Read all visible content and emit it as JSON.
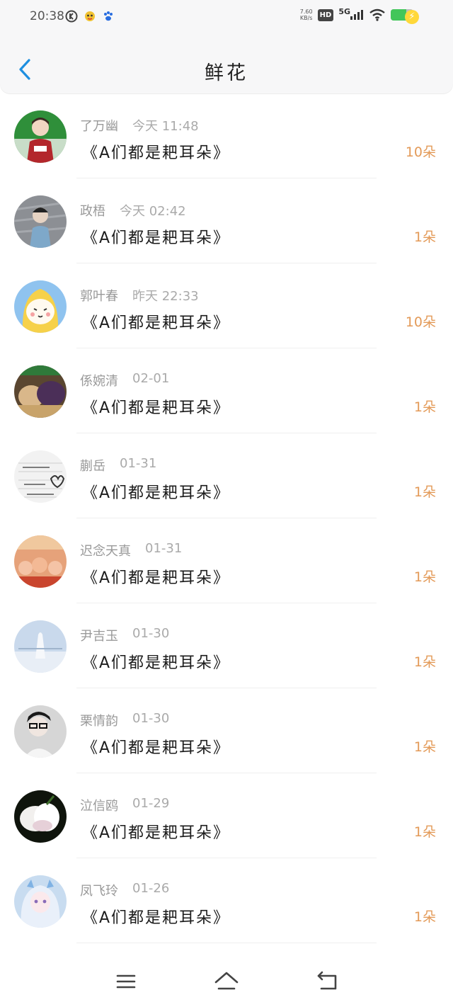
{
  "status_bar": {
    "time": "20:38",
    "net_speed_value": "7.60",
    "net_speed_unit": "KB/s",
    "hd": "HD",
    "network": "5G",
    "battery_level": 0.7
  },
  "header": {
    "title": "鲜花"
  },
  "gifts": [
    {
      "name": "了万幽",
      "time": "今天 11:48",
      "title": "《A们都是耙耳朵》",
      "count": "10朵"
    },
    {
      "name": "政梧",
      "time": "今天 02:42",
      "title": "《A们都是耙耳朵》",
      "count": "1朵"
    },
    {
      "name": "郭叶春",
      "time": "昨天 22:33",
      "title": "《A们都是耙耳朵》",
      "count": "10朵"
    },
    {
      "name": "係婉清",
      "time": "02-01",
      "title": "《A们都是耙耳朵》",
      "count": "1朵"
    },
    {
      "name": "蒯岳",
      "time": "01-31",
      "title": "《A们都是耙耳朵》",
      "count": "1朵"
    },
    {
      "name": "迟念天真",
      "time": "01-31",
      "title": "《A们都是耙耳朵》",
      "count": "1朵"
    },
    {
      "name": "尹吉玉",
      "time": "01-30",
      "title": "《A们都是耙耳朵》",
      "count": "1朵"
    },
    {
      "name": "栗情韵",
      "time": "01-30",
      "title": "《A们都是耙耳朵》",
      "count": "1朵"
    },
    {
      "name": "泣信鸥",
      "time": "01-29",
      "title": "《A们都是耙耳朵》",
      "count": "1朵"
    },
    {
      "name": "凤飞玲",
      "time": "01-26",
      "title": "《A们都是耙耳朵》",
      "count": "1朵"
    }
  ],
  "colors": {
    "accent": "#1e8fe0",
    "count": "#e39a58",
    "name": "#999999"
  },
  "icons": {
    "back": "chevron-left-icon",
    "menu": "menu-icon",
    "home": "home-icon",
    "return": "return-icon"
  }
}
